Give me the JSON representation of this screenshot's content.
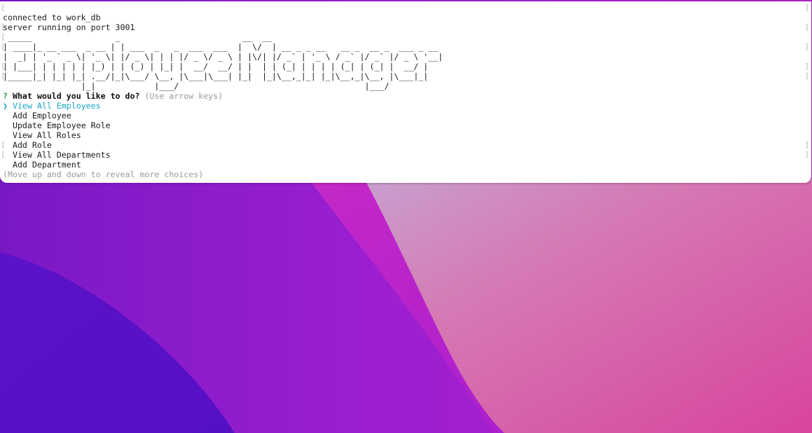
{
  "terminal": {
    "lines": {
      "connected": "connected to work_db",
      "server": "server running on port 3001"
    },
    "banner": " _____                 _                         __  __\n| ____|_ __ ___  _ __ | | ___  _   _  ___  ___  |  \\/  | __ _ _ __   __ _  __ _  ___ _ __\n|  _| | '_ ` _ \\| '_ \\| |/ _ \\| | | |/ _ \\/ _ \\ | |\\/| |/ _` | '_ \\ / _` |/ _` |/ _ \\ '__|\n| |___| | | | | | |_) | | (_) | |_| |  __/  __/ | |  | | (_| | | | | (_| | (_| |  __/ |\n|_____|_| |_| |_| .__/|_|\\___/ \\__, |\\___|\\___| |_|  |_|\\__,_|_| |_|\\__,_|\\__, |\\___|_|\n                |_|            |___/                                      |___/",
    "prompt": {
      "mark": "?",
      "question": "What would you like to do?",
      "hint": "(Use arrow keys)"
    },
    "pointer": "❯",
    "choices": [
      "View All Employees",
      "Add Employee",
      "Update Employee Role",
      "View All Roles",
      "Add Role",
      "View All Departments",
      "Add Department"
    ],
    "selected_index": 0,
    "footer_hint": "(Move up and down to reveal more choices)"
  },
  "colors": {
    "terminal_bg": "#ffffff",
    "selected_choice": "#1aa6c4",
    "prompt_mark": "#2ea043",
    "hint": "#9a9a9a",
    "wallpaper_left": "#5b14c8",
    "wallpaper_mid": "#9a1ccc",
    "wallpaper_right": "#d86aa8"
  }
}
